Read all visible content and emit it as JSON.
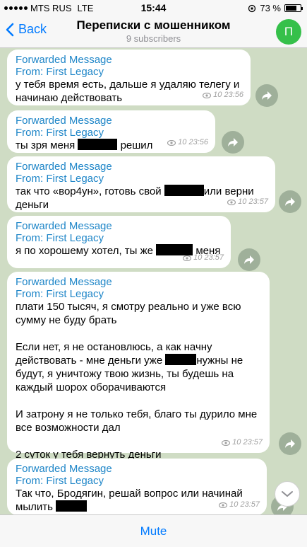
{
  "status_bar": {
    "carrier": "MTS RUS",
    "network": "LTE",
    "time": "15:44",
    "battery": "73 %",
    "battery_level": 0.73
  },
  "header": {
    "back_label": "Back",
    "title": "Переписки с мошенником",
    "subtitle": "9 subscribers",
    "avatar_letter": "П",
    "avatar_color": "#35c04a"
  },
  "forward_header": "Forwarded Message",
  "forward_from": "From: First Legacy",
  "messages": [
    {
      "line1": "у тебя время есть, дальше я удаляю телегу и",
      "line2": "начинаю действовать",
      "time": "10 23:56"
    },
    {
      "before": "ты зря меня",
      "after": "решил",
      "time": "10 23:56"
    },
    {
      "before": "так что «вор4ун», готовь свой",
      "after": "или верни",
      "line2": "деньги",
      "time": "10 23:57"
    },
    {
      "before": "я по хорошему хотел, ты же",
      "after": "меня",
      "time": "10 23:57"
    },
    {
      "p1": "плати 150 тысяч, я смотру реально и уже всю\nсумму не буду брать",
      "p2_line1": "Если нет, я не остановлюсь, а как начну",
      "p2_before": "действовать - мне деньги уже",
      "p2_after": "нужны не",
      "p2_line3": "будут, я уничтожу твою жизнь, ты будешь на\nкаждый шорох оборачиваются",
      "p3": "И затрону я не только тебя, благо ты дурило мне\nвсе возможности дал",
      "p4": "2 суток у тебя вернуть деньги",
      "time": "10 23:57"
    },
    {
      "line1": "Так что, Бродягин, решай вопрос или начинай",
      "before": "мылить",
      "time": "10 23:57"
    }
  ],
  "footer": {
    "mute_label": "Mute"
  }
}
